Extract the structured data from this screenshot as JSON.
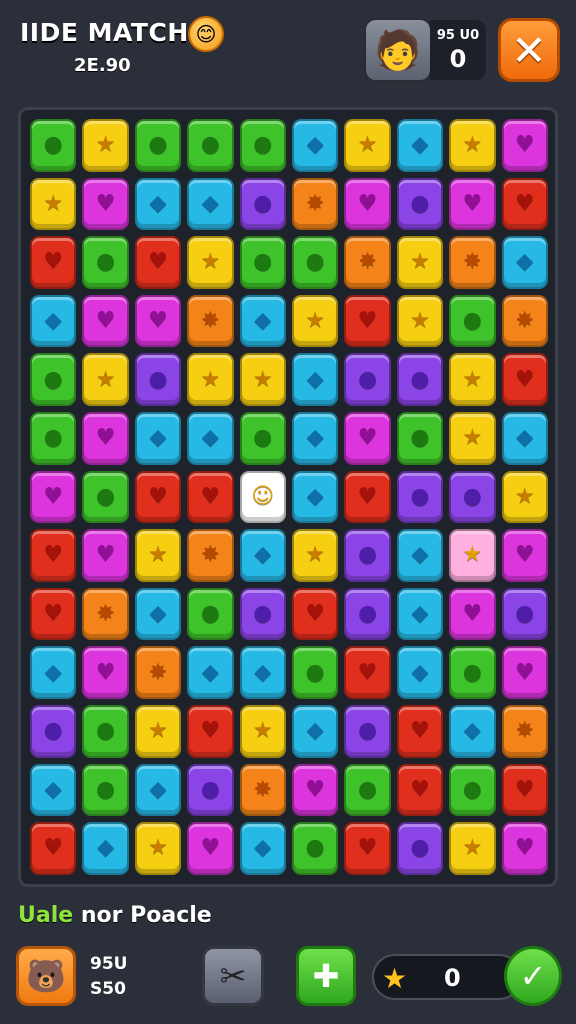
{
  "header": {
    "title": "IIDE MATCH",
    "badge_icon": "emoji-badge-icon",
    "score_text": "2E.90",
    "player_label": "95 U0",
    "player_score": "0",
    "close_glyph": "✕"
  },
  "board": {
    "colors": {
      "G": "#3fc32a",
      "Y": "#f6cf12",
      "C": "#27b9e6",
      "R": "#e02f1d",
      "O": "#f4841a",
      "M": "#dd35de",
      "P": "#8b45e6",
      "L": "#ffffff",
      "K": "#ffb0e0"
    },
    "rows": [
      [
        "G",
        "Y",
        "G",
        "G",
        "G",
        "C",
        "Y",
        "C",
        "Y",
        "M"
      ],
      [
        "Y",
        "M",
        "C",
        "C",
        "P",
        "O",
        "M",
        "P",
        "M",
        "R"
      ],
      [
        "R",
        "G",
        "R",
        "Y",
        "G",
        "G",
        "O",
        "Y",
        "O",
        "C"
      ],
      [
        "C",
        "M",
        "M",
        "O",
        "C",
        "Y",
        "R",
        "Y",
        "G",
        "O"
      ],
      [
        "G",
        "Y",
        "P",
        "Y",
        "Y",
        "C",
        "P",
        "P",
        "Y",
        "R"
      ],
      [
        "G",
        "M",
        "C",
        "C",
        "G",
        "C",
        "M",
        "G",
        "Y",
        "C"
      ],
      [
        "M",
        "G",
        "R",
        "R",
        "L",
        "C",
        "R",
        "P",
        "P",
        "Y"
      ],
      [
        "R",
        "M",
        "Y",
        "O",
        "C",
        "Y",
        "P",
        "C",
        "K",
        "M"
      ],
      [
        "R",
        "O",
        "C",
        "G",
        "P",
        "R",
        "P",
        "C",
        "M",
        "P"
      ],
      [
        "C",
        "M",
        "O",
        "C",
        "C",
        "G",
        "R",
        "C",
        "G",
        "M"
      ],
      [
        "P",
        "G",
        "Y",
        "R",
        "Y",
        "C",
        "P",
        "R",
        "C",
        "O"
      ],
      [
        "C",
        "G",
        "C",
        "P",
        "O",
        "M",
        "G",
        "R",
        "G",
        "R"
      ],
      [
        "R",
        "C",
        "Y",
        "M",
        "C",
        "G",
        "R",
        "P",
        "Y",
        "M"
      ]
    ],
    "glyphs": {
      "G": "●",
      "Y": "★",
      "C": "◆",
      "R": "♥",
      "O": "✸",
      "M": "♥",
      "P": "●",
      "L": "☺",
      "K": "★"
    },
    "glyph_colors": {
      "G": "#1d7a10",
      "Y": "#c97d00",
      "C": "#0f6fa8",
      "R": "#a5120a",
      "O": "#b54a00",
      "M": "#8f0f95",
      "P": "#4f1ea8",
      "L": "#e0a000",
      "K": "#e0a000"
    }
  },
  "footer": {
    "subtitle_first": "Uale",
    "subtitle_rest": " nor Poacle",
    "stat_line_1": "95U",
    "stat_line_2": "S50",
    "char_icon": "character-icon",
    "tool_glyph": "✂",
    "puzzle_glyph": "✚",
    "star_glyph": "★",
    "star_count": "0",
    "check_glyph": "✓"
  }
}
